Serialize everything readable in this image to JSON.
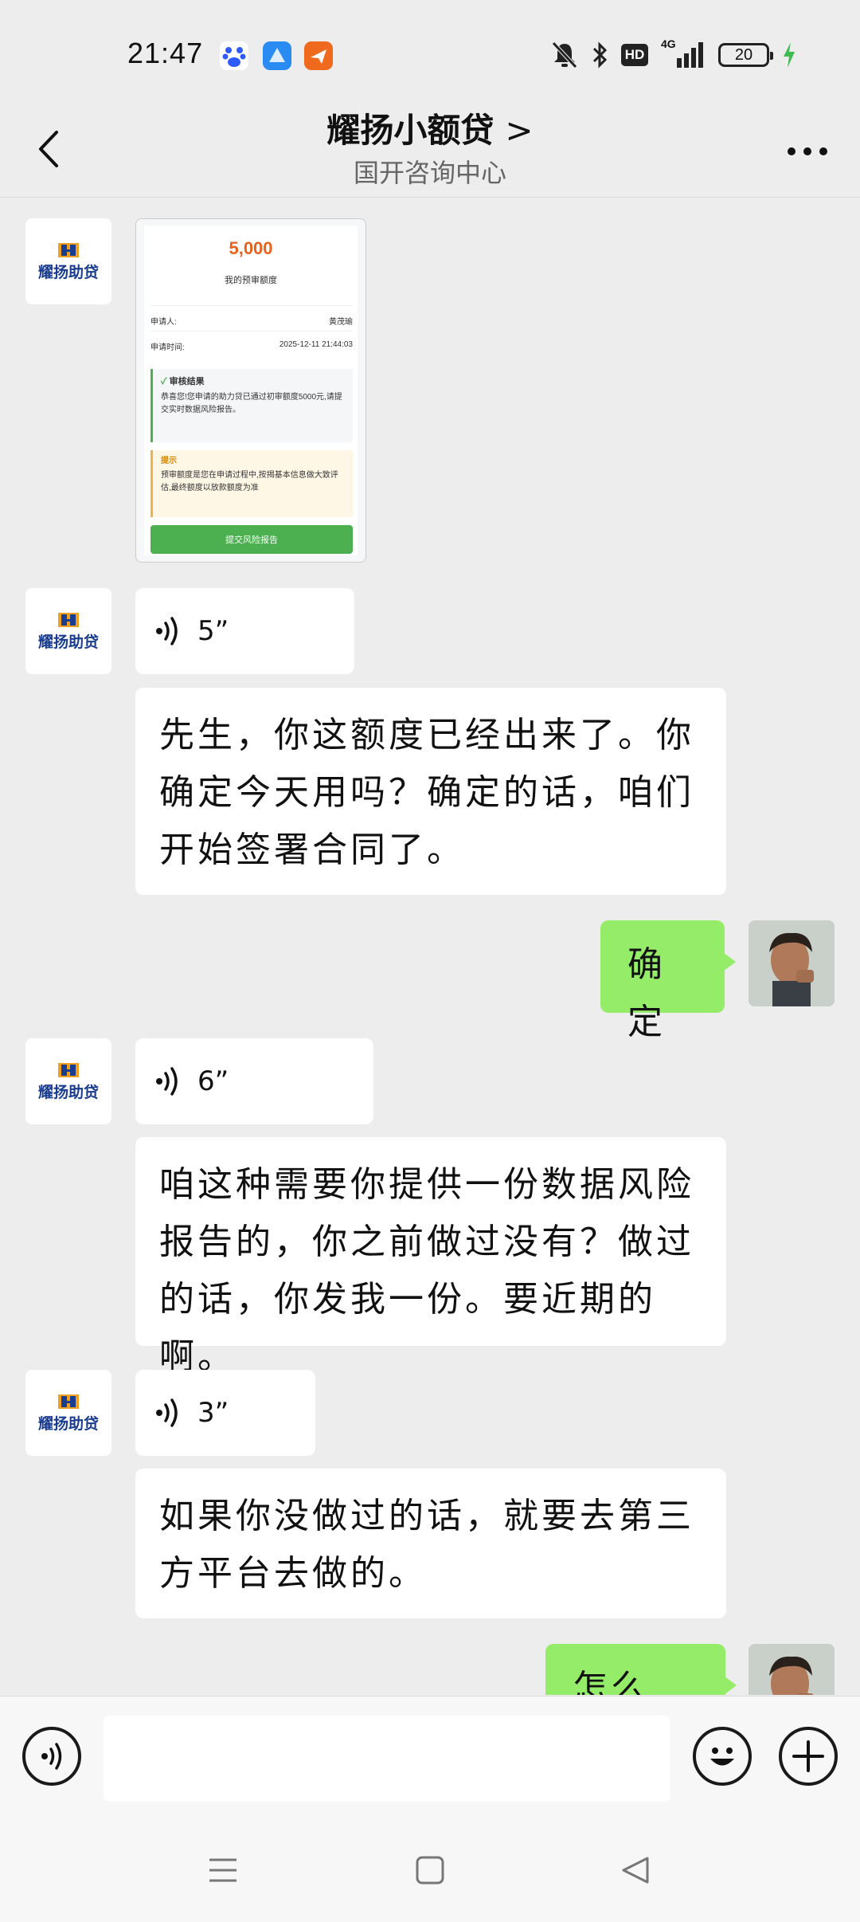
{
  "status_bar": {
    "time": "21:47",
    "signal": "4G",
    "battery": "20",
    "hd": "HD"
  },
  "nav": {
    "title": "耀扬小额贷",
    "title_arrow": ">",
    "subtitle": "国开咨询中心"
  },
  "brand_logo_text": "耀扬助贷",
  "card": {
    "amount": "5,000",
    "amount_label": "我的预审额度",
    "applicant_label": "申请人:",
    "applicant_value": "黄茂瑜",
    "time_label": "申请时间:",
    "time_value": "2025-12-11 21:44:03",
    "result_title": "审核结果",
    "result_text": "恭喜您!您申请的助力贷已通过初审额度5000元,请提交实时数据风险报告。",
    "tip_title": "提示",
    "tip_text": "预审额度是您在申请过程中,按揭基本信息做大致评估,最终额度以放款额度为准",
    "button_label": "提交风险报告"
  },
  "messages": {
    "voice_1": "5”",
    "text_1": "先生，你这额度已经出来了。你确定今天用吗？确定的话，咱们开始签署合同了。",
    "me_1": "确定",
    "voice_2": "6”",
    "text_2": "咱这种需要你提供一份数据风险报告的，你之前做过没有？做过的话，你发我一份。要近期的啊。",
    "voice_3": "3”",
    "text_3": "如果你没做过的话，就要去第三方平台去做的。",
    "me_2": "怎么做?"
  },
  "colors": {
    "background": "#ededed",
    "my_bubble": "#95ec69",
    "other_bubble": "#ffffff",
    "amount": "#e8621d",
    "card_button": "#4caf50"
  },
  "icons": [
    "baidu-icon",
    "app-icon",
    "flight-app-icon",
    "mute-icon",
    "bluetooth-icon",
    "signal-icon",
    "battery-icon",
    "back-icon",
    "more-icon",
    "voice-icon",
    "emoji-icon",
    "plus-icon",
    "menu-icon",
    "home-icon",
    "back-triangle-icon"
  ]
}
